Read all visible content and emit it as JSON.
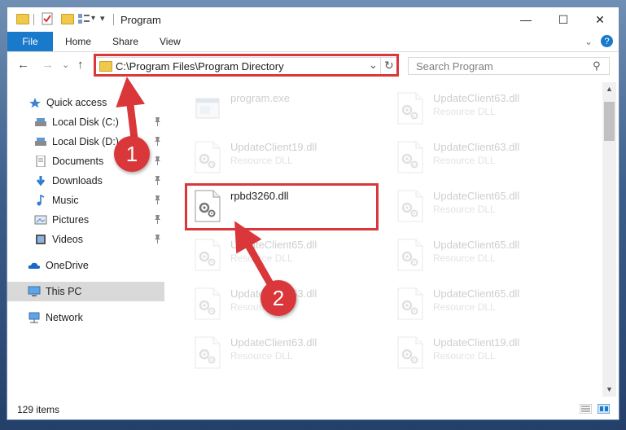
{
  "window": {
    "title": "Program",
    "controls": {
      "minimize": "—",
      "maximize": "☐",
      "close": "✕"
    }
  },
  "ribbon": {
    "tabs": [
      "File",
      "Home",
      "Share",
      "View"
    ],
    "expand_glyph": "⌄",
    "help_glyph": "?"
  },
  "navbar": {
    "back": "←",
    "forward": "→",
    "recent": "⌄",
    "up": "↑",
    "address": "C:\\Program Files\\Program Directory",
    "dropdown": "⌄",
    "refresh": "↻",
    "search_placeholder": "Search Program",
    "search_glyph": "⚲"
  },
  "sidebar": {
    "items": [
      {
        "label": "Quick access",
        "icon": "star-icon"
      },
      {
        "label": "Local Disk (C:)",
        "icon": "drive-icon",
        "pinned": true
      },
      {
        "label": "Local Disk (D:)",
        "icon": "drive-icon",
        "pinned": true
      },
      {
        "label": "Documents",
        "icon": "documents-icon",
        "pinned": true
      },
      {
        "label": "Downloads",
        "icon": "downloads-icon",
        "pinned": true
      },
      {
        "label": "Music",
        "icon": "music-icon",
        "pinned": true
      },
      {
        "label": "Pictures",
        "icon": "pictures-icon",
        "pinned": true
      },
      {
        "label": "Videos",
        "icon": "videos-icon",
        "pinned": true
      },
      {
        "label": "OneDrive",
        "icon": "cloud-icon"
      },
      {
        "label": "This PC",
        "icon": "computer-icon",
        "selected": true
      },
      {
        "label": "Network",
        "icon": "network-icon"
      }
    ],
    "pin_glyph": "📌"
  },
  "files": [
    {
      "name": "program.exe",
      "type": "",
      "col": 0,
      "row": 0,
      "kind": "exe"
    },
    {
      "name": "UpdateClient63.dll",
      "type": "Resource DLL",
      "col": 1,
      "row": 0,
      "kind": "dll"
    },
    {
      "name": "UpdateClient19.dll",
      "type": "Resource DLL",
      "col": 0,
      "row": 1,
      "kind": "dll"
    },
    {
      "name": "UpdateClient63.dll",
      "type": "Resource DLL",
      "col": 1,
      "row": 1,
      "kind": "dll"
    },
    {
      "name": "rpbd3260.dll",
      "type": "",
      "col": 0,
      "row": 2,
      "kind": "dll",
      "highlight": true
    },
    {
      "name": "UpdateClient65.dll",
      "type": "Resource DLL",
      "col": 1,
      "row": 2,
      "kind": "dll"
    },
    {
      "name": "UpdateClient65.dll",
      "type": "Resource DLL",
      "col": 0,
      "row": 3,
      "kind": "dll"
    },
    {
      "name": "UpdateClient65.dll",
      "type": "Resource DLL",
      "col": 1,
      "row": 3,
      "kind": "dll"
    },
    {
      "name": "UpdateClient63.dll",
      "type": "Resource DLL",
      "col": 0,
      "row": 4,
      "kind": "dll"
    },
    {
      "name": "UpdateClient65.dll",
      "type": "Resource DLL",
      "col": 1,
      "row": 4,
      "kind": "dll"
    },
    {
      "name": "UpdateClient63.dll",
      "type": "Resource DLL",
      "col": 0,
      "row": 5,
      "kind": "dll"
    },
    {
      "name": "UpdateClient19.dll",
      "type": "Resource DLL",
      "col": 1,
      "row": 5,
      "kind": "dll"
    }
  ],
  "status": {
    "item_count": "129 items"
  },
  "annotations": {
    "step1": "1",
    "step2": "2",
    "color": "#d9373a"
  }
}
